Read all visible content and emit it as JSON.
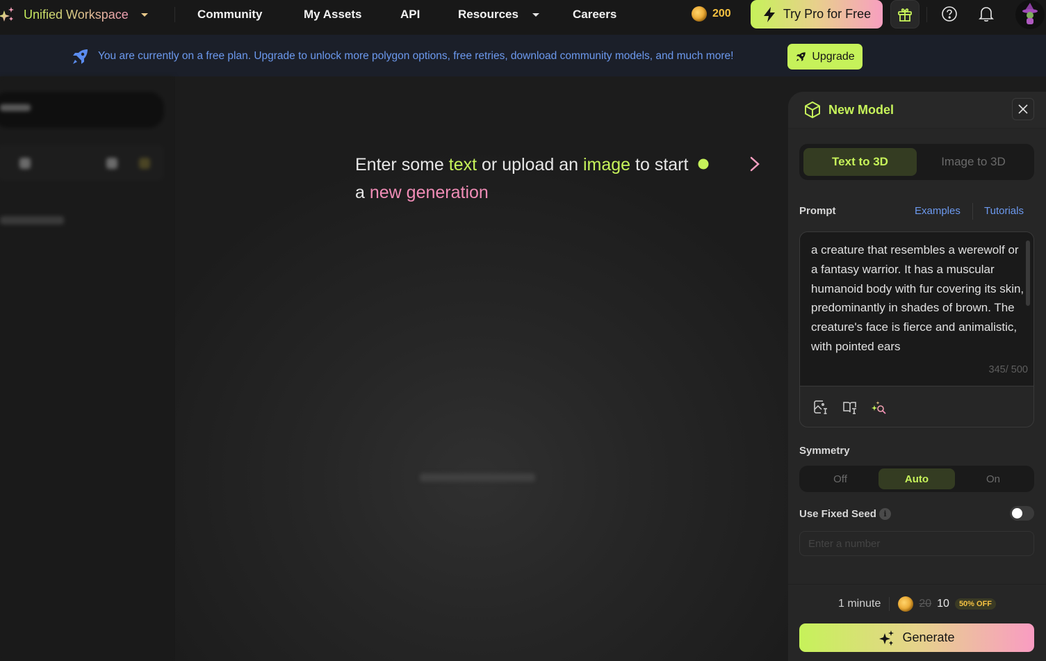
{
  "topbar": {
    "workspace_label": "Unified Workspace",
    "nav": [
      {
        "label": "Community"
      },
      {
        "label": "My Assets"
      },
      {
        "label": "API"
      },
      {
        "label": "Resources"
      },
      {
        "label": "Careers"
      }
    ],
    "coins": "200",
    "try_pro_label": "Try Pro for Free",
    "icons": [
      "sparkle-icon",
      "gift-icon",
      "help-icon",
      "bell-icon",
      "avatar"
    ]
  },
  "banner": {
    "text": "You are currently on a free plan. Upgrade to unlock more polygon options, free retries, download community models, and much more!",
    "upgrade_label": "Upgrade"
  },
  "canvas": {
    "hint_parts": {
      "p1": "Enter some ",
      "h1": "text",
      "p2": " or upload an ",
      "h2": "image",
      "p3": " to start a ",
      "h3": "new generation"
    }
  },
  "panel": {
    "title": "New Model",
    "modes": [
      "Text to 3D",
      "Image to 3D"
    ],
    "active_mode": "Text to 3D",
    "prompt_label": "Prompt",
    "examples_label": "Examples",
    "tutorials_label": "Tutorials",
    "prompt_value": "a creature that resembles a werewolf or a fantasy warrior. It has a muscular humanoid body with fur covering its skin, predominantly in shades of brown. The creature's face is fierce and animalistic, with pointed ears",
    "char_count": "345/ 500",
    "symmetry_label": "Symmetry",
    "symmetry_options": [
      "Off",
      "Auto",
      "On"
    ],
    "symmetry_selected": "Auto",
    "fixed_seed_label": "Use Fixed Seed",
    "fixed_seed_enabled": false,
    "seed_placeholder": "Enter a number",
    "time_estimate": "1 minute",
    "old_cost": "20",
    "new_cost": "10",
    "discount_badge": "50% OFF",
    "generate_label": "Generate"
  },
  "colors": {
    "accent_green": "#c6f25a",
    "accent_pink": "#f08cb6",
    "link_blue": "#6c99ee",
    "coin_gold": "#f5c242"
  }
}
